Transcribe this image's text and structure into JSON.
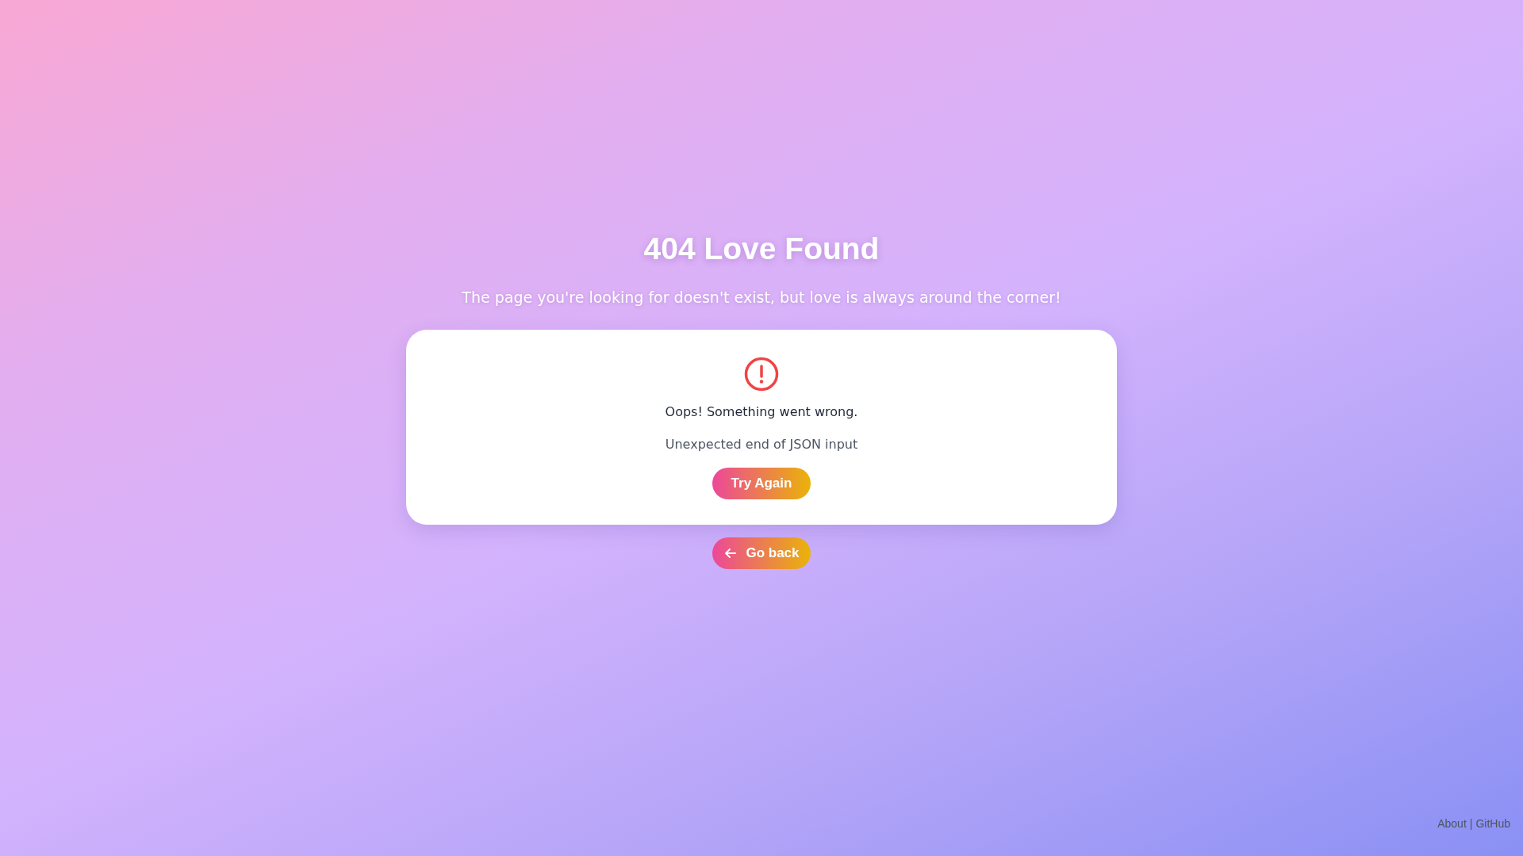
{
  "title": "404 Love Found",
  "subtitle": "The page you're looking for doesn't exist, but love is always around the corner!",
  "error_card": {
    "heading": "Oops! Something went wrong.",
    "message": "Unexpected end of JSON input",
    "button": "Try Again"
  },
  "back_button": "Go back",
  "footer": {
    "links": [
      "About",
      "GitHub"
    ],
    "separator": "|"
  }
}
